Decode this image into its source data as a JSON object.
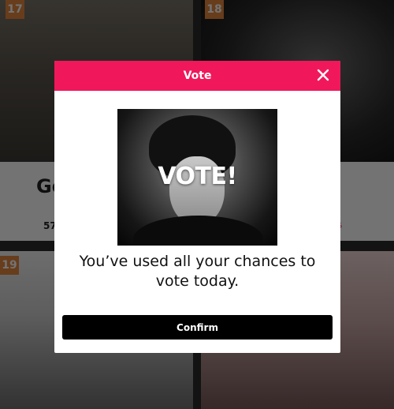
{
  "background": {
    "cards": [
      {
        "rank": "17"
      },
      {
        "rank": "18"
      },
      {
        "rank": "19"
      }
    ],
    "partial_name": "Go",
    "partial_votes": "57",
    "partial_red": "5"
  },
  "modal": {
    "title": "Vote",
    "image_caption": "VOTE!",
    "message": "You’ve used all your chances to vote today.",
    "confirm_label": "Confirm"
  },
  "colors": {
    "header": "#f0185b",
    "confirm_bg": "#000000",
    "rank_badge": "#e5883e"
  },
  "icons": {
    "close": "close-icon"
  }
}
